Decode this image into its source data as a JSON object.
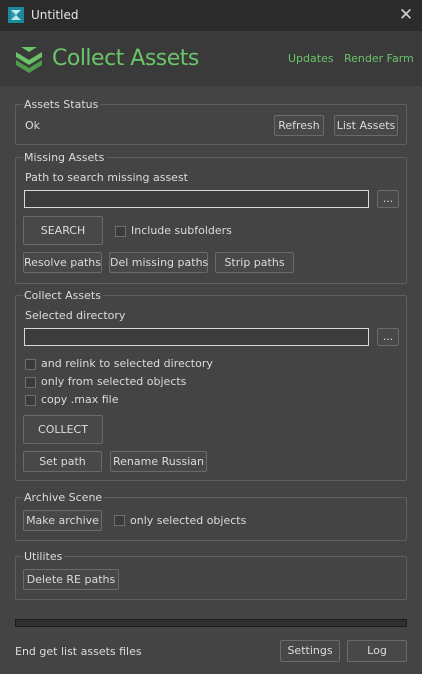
{
  "window": {
    "title": "Untitled",
    "close": "✕"
  },
  "header": {
    "brand": "Collect Assets",
    "updates": "Updates",
    "render_farm": "Render Farm"
  },
  "assets_status": {
    "label": "Assets Status",
    "status": "Ok",
    "refresh": "Refresh",
    "list_assets": "List Assets"
  },
  "missing_assets": {
    "label": "Missing Assets",
    "path_label": "Path to search missing assest",
    "path_value": "",
    "browse": "...",
    "search": "SEARCH",
    "include_subfolders": "Include subfolders",
    "include_subfolders_checked": false,
    "resolve_paths": "Resolve paths",
    "del_missing_paths": "Del missing paths",
    "strip_paths": "Strip paths"
  },
  "collect_assets": {
    "label": "Collect Assets",
    "dir_label": "Selected directory",
    "dir_value": "",
    "browse": "...",
    "relink": "and relink to selected directory",
    "selected_only": "only from selected objects",
    "copy_max": "copy .max file",
    "collect": "COLLECT",
    "set_path": "Set path",
    "rename_russian": "Rename Russian"
  },
  "archive_scene": {
    "label": "Archive Scene",
    "make_archive": "Make archive",
    "only_selected": "only selected objects"
  },
  "utilites": {
    "label": "Utilites",
    "delete_re_paths": "Delete RE paths"
  },
  "footer": {
    "progress": 0,
    "status": "End get list assets files",
    "settings": "Settings",
    "log": "Log"
  },
  "colors": {
    "accent": "#6ac46a",
    "background": "#444444",
    "titlebar": "#2b2b2b",
    "header": "#3a3a3a"
  }
}
